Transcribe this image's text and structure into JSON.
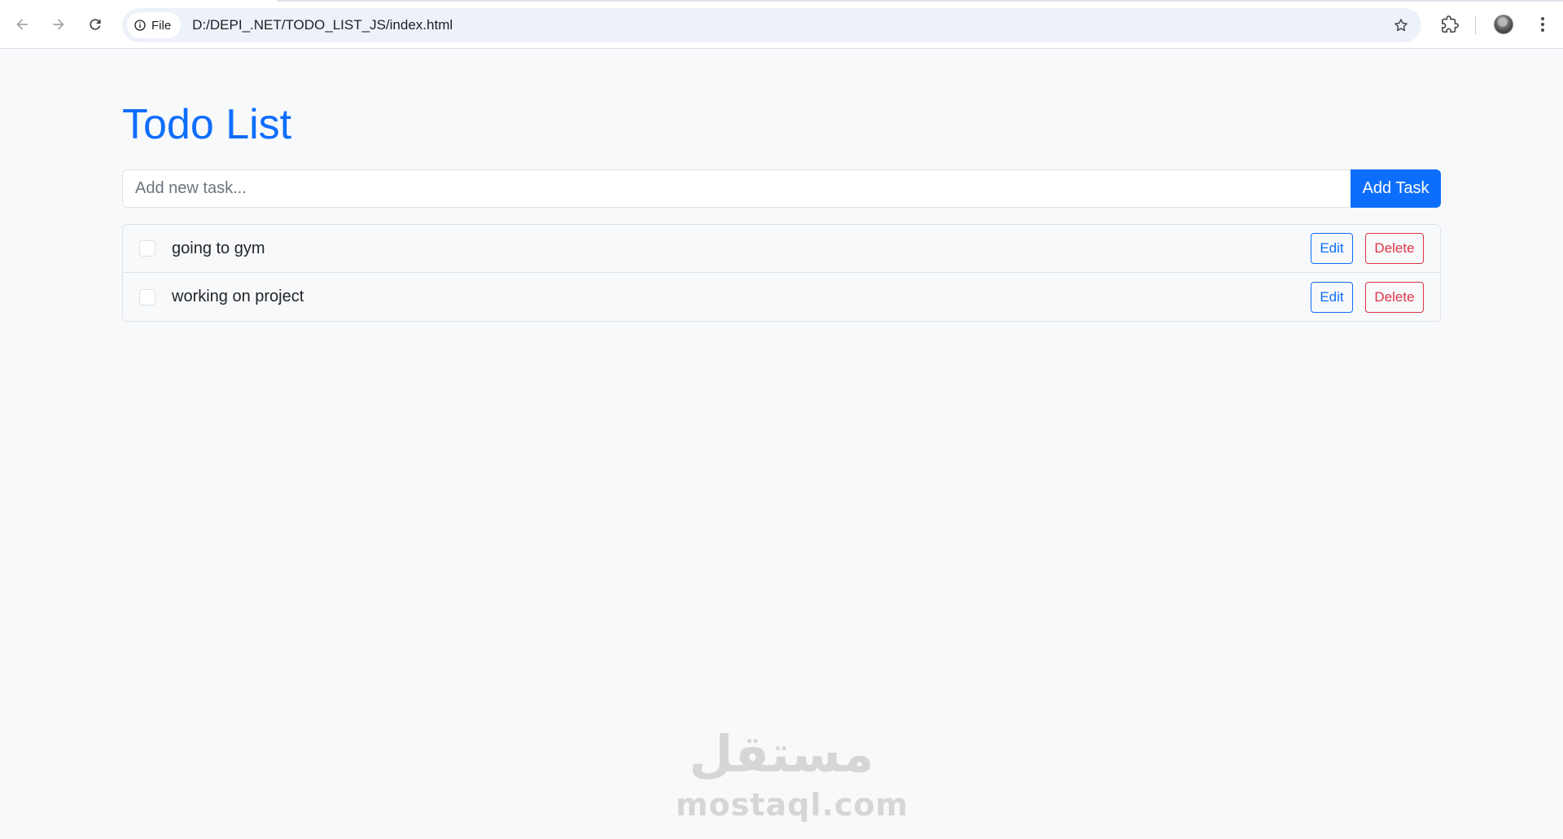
{
  "browser": {
    "site_chip_label": "File",
    "url": "D:/DEPI_.NET/TODO_LIST_JS/index.html"
  },
  "page": {
    "title": "Todo List",
    "input_placeholder": "Add new task...",
    "add_button_label": "Add Task"
  },
  "tasks": [
    {
      "label": "going to gym",
      "done": false,
      "edit_label": "Edit",
      "delete_label": "Delete"
    },
    {
      "label": "working on project",
      "done": false,
      "edit_label": "Edit",
      "delete_label": "Delete"
    }
  ],
  "watermark": {
    "arabic": "مستقل",
    "latin": "mostaql.com"
  },
  "colors": {
    "accent": "#0d6efd",
    "danger": "#dc3545",
    "page_background": "#f8f9fa"
  },
  "icons": [
    "back-arrow-icon",
    "forward-arrow-icon",
    "reload-icon",
    "info-icon",
    "star-icon",
    "extensions-icon",
    "profile-avatar",
    "more-menu-icon"
  ]
}
